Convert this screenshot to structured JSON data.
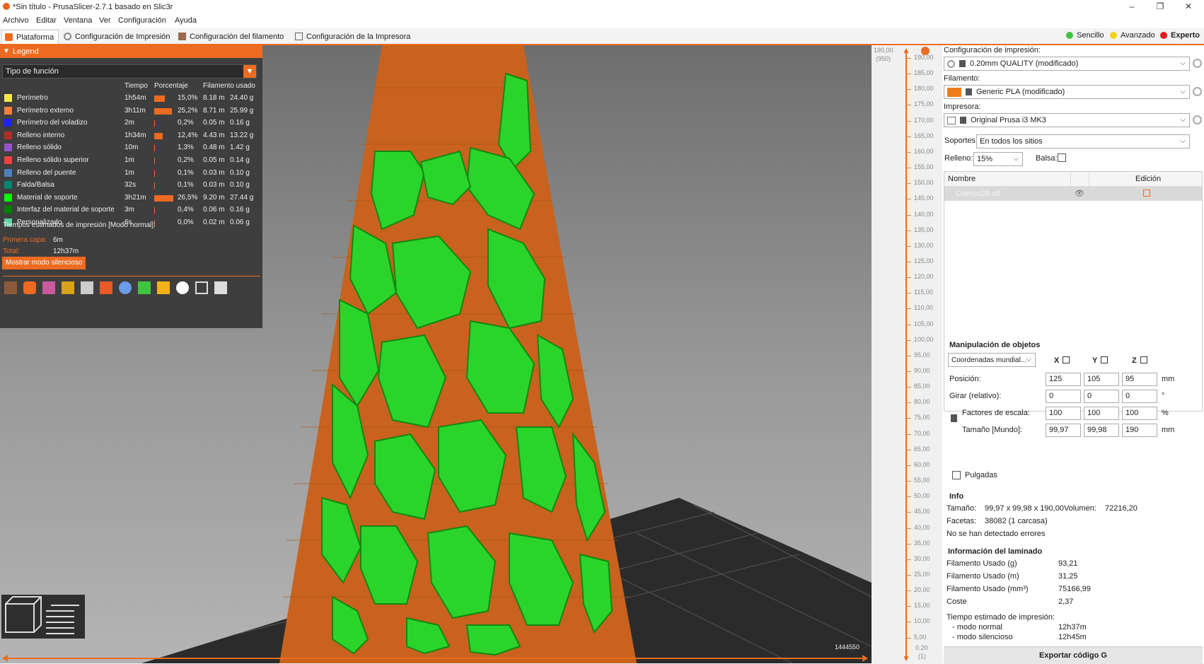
{
  "window": {
    "title": "*Sin título - PrusaSlicer-2.7.1 basado en Slic3r",
    "min": "–",
    "max": "❐",
    "close": "✕"
  },
  "menu": [
    "Archivo",
    "Editar",
    "Ventana",
    "Ver",
    "Configuración",
    "Ayuda"
  ],
  "tabs": [
    "Plataforma",
    "Configuración de Impresión",
    "Configuración del filamento",
    "Configuración de la Impresora"
  ],
  "modes": [
    {
      "label": "Sencillo",
      "color": "#3ec43e"
    },
    {
      "label": "Avanzado",
      "color": "#f2d21b"
    },
    {
      "label": "Experto",
      "color": "#e21c1c"
    }
  ],
  "legend": {
    "title": "Legend",
    "view_type": "Tipo de función",
    "columns": [
      "Tiempo",
      "Porcentaje",
      "Filamento usado"
    ],
    "rows": [
      {
        "name": "Perímetro",
        "color": "#ffe64d",
        "time": "1h54m",
        "pct": "15,0%",
        "pct_value": 15.0,
        "len": "8.18 m",
        "weight": "24.40 g"
      },
      {
        "name": "Perímetro externo",
        "color": "#ff7d38",
        "time": "3h11m",
        "pct": "25,2%",
        "pct_value": 25.2,
        "len": "8.71 m",
        "weight": "25.99 g"
      },
      {
        "name": "Perímetro del voladizo",
        "color": "#1f1fff",
        "time": "2m",
        "pct": "0,2%",
        "pct_value": 0.2,
        "len": "0.05 m",
        "weight": "0.16 g"
      },
      {
        "name": "Relleno interno",
        "color": "#b03029",
        "time": "1h34m",
        "pct": "12,4%",
        "pct_value": 12.4,
        "len": "4.43 m",
        "weight": "13.22 g"
      },
      {
        "name": "Relleno sólido",
        "color": "#9654cc",
        "time": "10m",
        "pct": "1,3%",
        "pct_value": 1.3,
        "len": "0.48 m",
        "weight": "1.42 g"
      },
      {
        "name": "Relleno sólido superior",
        "color": "#f04040",
        "time": "1m",
        "pct": "0,2%",
        "pct_value": 0.2,
        "len": "0.05 m",
        "weight": "0.14 g"
      },
      {
        "name": "Relleno del puente",
        "color": "#4d80ba",
        "time": "1m",
        "pct": "0,1%",
        "pct_value": 0.1,
        "len": "0.03 m",
        "weight": "0.10 g"
      },
      {
        "name": "Falda/Balsa",
        "color": "#00876e",
        "time": "32s",
        "pct": "0,1%",
        "pct_value": 0.1,
        "len": "0.03 m",
        "weight": "0.10 g"
      },
      {
        "name": "Material de soporte",
        "color": "#00ff00",
        "time": "3h21m",
        "pct": "26,5%",
        "pct_value": 26.5,
        "len": "9.20 m",
        "weight": "27.44 g"
      },
      {
        "name": "Interfaz del material de soporte",
        "color": "#008000",
        "time": "3m",
        "pct": "0,4%",
        "pct_value": 0.4,
        "len": "0.06 m",
        "weight": "0.16 g"
      },
      {
        "name": "Personalizado",
        "color": "#5ed19c",
        "time": "6s",
        "pct": "0,0%",
        "pct_value": 0.0,
        "len": "0.02 m",
        "weight": "0.06 g"
      }
    ],
    "estimated_title": "Tiempos estimados de impresión [Modo normal]:",
    "first_layer_label": "Primera capa:",
    "first_layer_value": "6m",
    "total_label": "Total:",
    "total_value": "12h37m",
    "silent_button": "Mostrar modo silencioso"
  },
  "ruler": {
    "top_value": "190,00",
    "top_sub": "(950)",
    "ticks": [
      "190,00",
      "185,00",
      "180,00",
      "175,00",
      "170,00",
      "165,00",
      "160,00",
      "155,00",
      "150,00",
      "145,00",
      "140,00",
      "135,00",
      "130,00",
      "125,00",
      "120,00",
      "115,00",
      "110,00",
      "105,00",
      "100,00",
      "95,00",
      "90,00",
      "85,00",
      "80,00",
      "75,00",
      "70,00",
      "65,00",
      "60,00",
      "55,00",
      "50,00",
      "45,00",
      "40,00",
      "35,00",
      "30,00",
      "25,00",
      "20,00",
      "15,00",
      "10,00",
      "5,00"
    ],
    "bottom_value": "0,20",
    "bottom_sub": "(1)",
    "moves": "1444550"
  },
  "right": {
    "print_label": "Configuración de impresión:",
    "print_value": "0.20mm QUALITY (modificado)",
    "filament_label": "Filamento:",
    "filament_value": "Generic PLA (modificado)",
    "filament_color": "#ed7d1c",
    "printer_label": "Impresora:",
    "printer_value": "Original Prusa i3 MK3",
    "supports_label": "Soportes:",
    "supports_value": "En todos los sitios",
    "infill_label": "Relleno:",
    "infill_value": "15%",
    "brim_label": "Balsa:",
    "list_col_name": "Nombre",
    "list_col_edit": "Edición",
    "object_name": "Cuerpo29.stl",
    "manip_title": "Manipulación de objetos",
    "coord_value": "Coordenadas mundial...",
    "axis_x": "X",
    "axis_y": "Y",
    "axis_z": "Z",
    "position_label": "Posición:",
    "position": [
      "125",
      "105",
      "95"
    ],
    "position_unit": "mm",
    "rotate_label": "Girar (relativo):",
    "rotate": [
      "0",
      "0",
      "0"
    ],
    "rotate_unit": "°",
    "scale_label": "Factores de escala:",
    "scale": [
      "100",
      "100",
      "100"
    ],
    "scale_unit": "%",
    "size_label": "Tamaño [Mundo]:",
    "size": [
      "99,97",
      "99,98",
      "190"
    ],
    "size_unit": "mm",
    "inches_label": "Pulgadas",
    "info_title": "Info",
    "info_size_label": "Tamaño:",
    "info_size_value": "99,97 x 99,98 x 190,00",
    "info_volume_label": "Volumen:",
    "info_volume_value": "72216,20",
    "info_facets_label": "Facetas:",
    "info_facets_value": "38082 (1 carcasa)",
    "info_errors": "No se han detectado errores",
    "slice_title": "Información del laminado",
    "slice_rows": [
      {
        "label": "Filamento Usado (g)",
        "value": "93,21"
      },
      {
        "label": "Filamento Usado (m)",
        "value": "31,25"
      },
      {
        "label": "Filamento Usado (mm³)",
        "value": "75166,99"
      },
      {
        "label": "Coste",
        "value": "2,37"
      }
    ],
    "time_title": "Tiempo estimado de impresión:",
    "time_normal_label": "- modo normal",
    "time_normal_value": "12h37m",
    "time_silent_label": "- modo silencioso",
    "time_silent_value": "12h45m",
    "export_button": "Exportar código G"
  }
}
